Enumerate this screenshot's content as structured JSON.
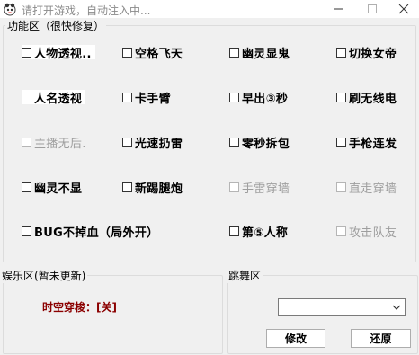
{
  "window": {
    "title": "请打开游戏，自动注入中..."
  },
  "feature_group": {
    "title": "功能区（很快修复）",
    "items": [
      {
        "label": "人物透视.."
      },
      {
        "label": "空格飞天"
      },
      {
        "label": "幽灵显鬼"
      },
      {
        "label": "切换女帝"
      },
      {
        "label": "人名透视"
      },
      {
        "label": "卡手臂"
      },
      {
        "label": "早出③秒"
      },
      {
        "label": "刷无线电"
      },
      {
        "label": "主播无后."
      },
      {
        "label": "光速扔雷"
      },
      {
        "label": "零秒拆包"
      },
      {
        "label": "手枪连发"
      },
      {
        "label": "幽灵不显"
      },
      {
        "label": "新踢腿炮"
      },
      {
        "label": "手雷穿墙"
      },
      {
        "label": "直走穿墙"
      },
      {
        "label": "BUG不掉血（局外开）"
      },
      {
        "label": "第⑤人称"
      },
      {
        "label": "攻击队友"
      }
    ]
  },
  "entertainment_group": {
    "title": "娱乐区(暂未更新)",
    "status_text": "时空穿梭：[关]"
  },
  "dance_group": {
    "title": "跳舞区",
    "select_value": "",
    "modify_label": "修改",
    "restore_label": "还原"
  },
  "colors": {
    "status_red": "#8b0000",
    "disabled_text": "#9e9e9e"
  }
}
